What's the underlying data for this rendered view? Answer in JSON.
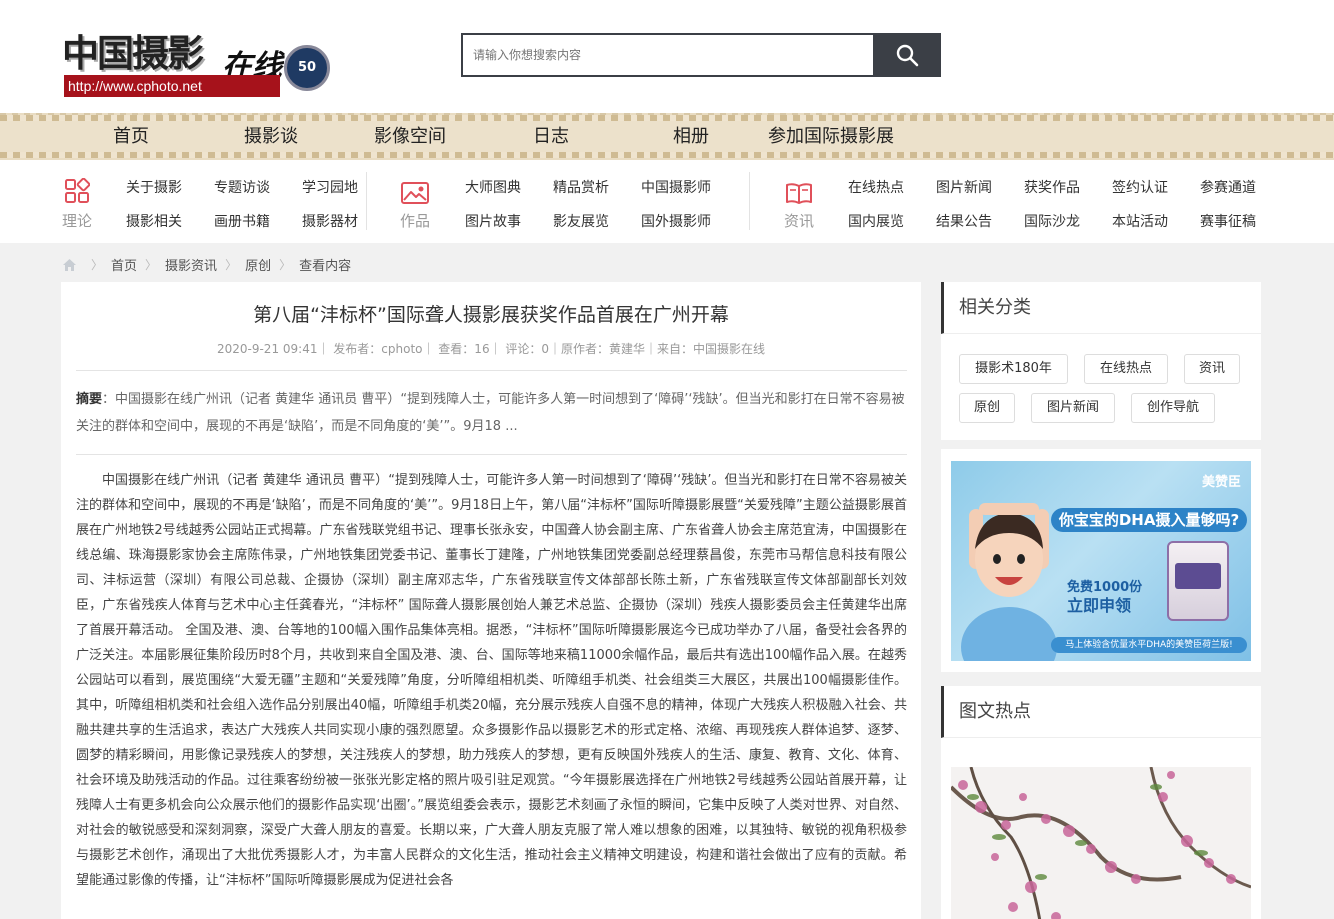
{
  "header": {
    "logo_main": "中国摄影",
    "logo_script": "在线",
    "logo_url": "http://www.cphoto.net",
    "logo_badge": "50",
    "search_placeholder": "请输入你想搜索内容"
  },
  "main_nav": [
    "首页",
    "摄影谈",
    "影像空间",
    "日志",
    "相册",
    "参加国际摄影展"
  ],
  "sub_nav": {
    "groups": [
      {
        "label": "理论",
        "icon": "grid-icon",
        "links": [
          "关于摄影",
          "专题访谈",
          "学习园地",
          "摄影相关",
          "画册书籍",
          "摄影器材"
        ]
      },
      {
        "label": "作品",
        "icon": "picture-icon",
        "links": [
          "大师图典",
          "精品赏析",
          "中国摄影师",
          "图片故事",
          "影友展览",
          "国外摄影师"
        ]
      },
      {
        "label": "资讯",
        "icon": "book-icon",
        "links": [
          "在线热点",
          "图片新闻",
          "获奖作品",
          "签约认证",
          "参赛通道",
          "国内展览",
          "结果公告",
          "国际沙龙",
          "本站活动",
          "赛事征稿"
        ]
      }
    ]
  },
  "breadcrumb": [
    "首页",
    "摄影资讯",
    "原创",
    "查看内容"
  ],
  "article": {
    "title": "第八届“沣标杯”国际聋人摄影展获奖作品首展在广州开幕",
    "meta": "2020-9-21 09:41｜ 发布者：cphoto｜ 查看：16｜ 评论：0｜原作者：黄建华｜来自：中国摄影在线",
    "summary_label": "摘要",
    "summary": "：中国摄影在线广州讯（记者 黄建华 通讯员 曹平）“提到残障人士，可能许多人第一时间想到了‘障碍’‘残缺’。但当光和影打在日常不容易被关注的群体和空间中，展现的不再是‘缺陷’，而是不同角度的‘美’”。9月18 ...",
    "body": "中国摄影在线广州讯（记者 黄建华 通讯员 曹平）“提到残障人士，可能许多人第一时间想到了‘障碍’‘残缺’。但当光和影打在日常不容易被关注的群体和空间中，展现的不再是‘缺陷’，而是不同角度的‘美’”。9月18日上午，第八届“沣标杯”国际听障摄影展暨“关爱残障”主题公益摄影展首展在广州地铁2号线越秀公园站正式揭幕。广东省残联党组书记、理事长张永安，中国聋人协会副主席、广东省聋人协会主席范宜涛，中国摄影在线总编、珠海摄影家协会主席陈伟录，广州地铁集团党委书记、董事长丁建隆，广州地铁集团党委副总经理蔡昌俊，东莞市马帮信息科技有限公司、沣标运营（深圳）有限公司总裁、企摄协（深圳）副主席邓志华，广东省残联宣传文体部部长陈土新，广东省残联宣传文体部副部长刘效臣，广东省残疾人体育与艺术中心主任龚春光，“沣标杯” 国际聋人摄影展创始人兼艺术总监、企摄协（深圳）残疾人摄影委员会主任黄建华出席了首展开幕活动。 全国及港、澳、台等地的100幅入围作品集体亮相。据悉，“沣标杯”国际听障摄影展迄今已成功举办了八届，备受社会各界的广泛关注。本届影展征集阶段历时8个月，共收到来自全国及港、澳、台、国际等地来稿11000余幅作品，最后共有选出100幅作品入展。在越秀公园站可以看到，展览围绕“大爱无疆”主题和“关爱残障”角度，分听障组相机类、听障组手机类、社会组类三大展区，共展出100幅摄影佳作。其中，听障组相机类和社会组入选作品分别展出40幅，听障组手机类20幅，充分展示残疾人自强不息的精神，体现广大残疾人积极融入社会、共融共建共享的生活追求，表达广大残疾人共同实现小康的强烈愿望。众多摄影作品以摄影艺术的形式定格、浓缩、再现残疾人群体追梦、逐梦、圆梦的精彩瞬间，用影像记录残疾人的梦想，关注残疾人的梦想，助力残疾人的梦想，更有反映国外残疾人的生活、康复、教育、文化、体育、社会环境及助残活动的作品。过往乘客纷纷被一张张光影定格的照片吸引驻足观赏。“今年摄影展选择在广州地铁2号线越秀公园站首展开幕，让残障人士有更多机会向公众展示他们的摄影作品实现‘出圈’。”展览组委会表示，摄影艺术刻画了永恒的瞬间，它集中反映了人类对世界、对自然、对社会的敏锐感受和深刻洞察，深受广大聋人朋友的喜爱。长期以来，广大聋人朋友克服了常人难以想象的困难，以其独特、敏锐的视角积极参与摄影艺术创作，涌现出了大批优秀摄影人才，为丰富人民群众的文化生活，推动社会主义精神文明建设，构建和谐社会做出了应有的贡献。希望能通过影像的传播，让“沣标杯”国际听障摄影展成为促进社会各"
  },
  "sidebar": {
    "related_title": "相关分类",
    "tags": [
      "摄影术180年",
      "在线热点",
      "资讯",
      "原创",
      "图片新闻",
      "创作导航"
    ],
    "ad": {
      "brand": "美赞臣",
      "headline": "你宝宝的DHA摄入量够吗?",
      "offer_line1": "免费1000份",
      "offer_line2": "立即申领",
      "footer": "马上体验含优量水平DHA的美赞臣荷兰版!"
    },
    "hot_title": "图文热点"
  }
}
